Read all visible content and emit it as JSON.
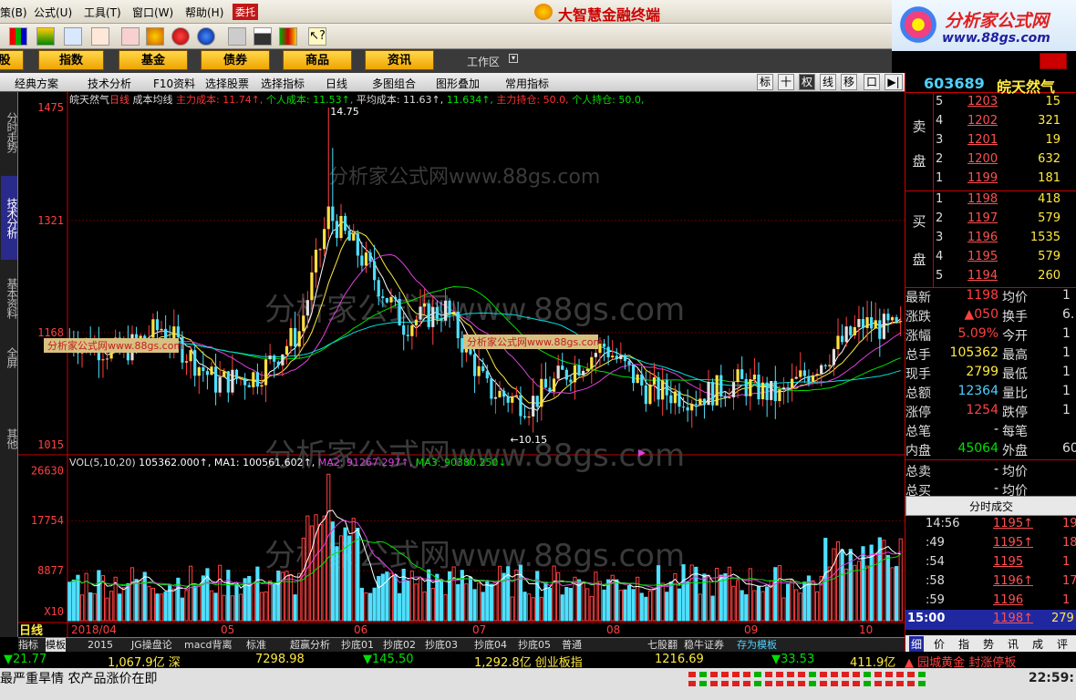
{
  "menu": {
    "items": [
      "策(B)",
      "公式(U)",
      "工具(T)",
      "窗口(W)",
      "帮助(H)"
    ],
    "weituo": "委托",
    "brand": "大智慧金融终端"
  },
  "logo": {
    "title": "分析家公式网",
    "url": "www.88gs.com"
  },
  "categories": [
    "股",
    "指数",
    "基金",
    "债券",
    "商品",
    "资讯"
  ],
  "workspace_label": "工作区",
  "subtoolbar": {
    "left": [
      "经典方案",
      "技术分析",
      "F10资料",
      "选择股票",
      "选择指标",
      "日线",
      "多图组合",
      "图形叠加",
      "常用指标"
    ],
    "right": [
      "标",
      "十",
      "权",
      "线",
      "移",
      "口",
      "▶|"
    ]
  },
  "left_tabs": [
    "分时走势",
    "技术分析",
    "基本资料",
    "全屏",
    "其他"
  ],
  "chart": {
    "header": {
      "name": "皖天然气",
      "period": "日线",
      "indicator": "成本均线",
      "items": [
        {
          "text": "主力成本: 11.74↑,",
          "color": "#ff3030"
        },
        {
          "text": "个人成本: 11.53↑,",
          "color": "#00e000"
        },
        {
          "text": "平均成本: 11.63↑,",
          "color": "#dddddd"
        },
        {
          "text": "11.634↑,",
          "color": "#00e000"
        },
        {
          "text": "主力持仓: 50.0,",
          "color": "#ff3030"
        },
        {
          "text": "个人持仓: 50.0,",
          "color": "#00e000"
        }
      ]
    },
    "price_axis": [
      "1475",
      "1321",
      "1168",
      "1015"
    ],
    "high_label": "14.75",
    "low_label": "←10.15",
    "vol_header": [
      {
        "text": "VOL(5,10,20)",
        "color": "#dddddd"
      },
      {
        "text": "105362.000↑,",
        "color": "#ffffff"
      },
      {
        "text": "MA1: 100561.602↑,",
        "color": "#ffffff"
      },
      {
        "text": "MA2: 91267.297↑,",
        "color": "#e040e0"
      },
      {
        "text": "MA3: 90380.250↓",
        "color": "#00e000"
      }
    ],
    "vol_axis": [
      "26630",
      "17754",
      "8877",
      "X10"
    ],
    "month_labels": [
      "2018/04",
      "05",
      "06",
      "07",
      "08",
      "09",
      "10"
    ],
    "watermark": "分析家公式网www.88gs.com",
    "label_box": "分析家公式网www.88gs.com",
    "period_label": "日线"
  },
  "bottom_tabs": [
    "指标",
    "模板",
    "2015",
    "JG操盘论",
    "macd背离",
    "标准",
    "超赢分析",
    "抄底01",
    "抄底02",
    "抄底03",
    "抄底04",
    "抄底05",
    "普通",
    "七股翻",
    "稳牛证券",
    "存为模板"
  ],
  "right_panel": {
    "code": "603689",
    "name": "皖天然气",
    "sell_label": [
      "卖",
      "盘"
    ],
    "buy_label": [
      "买",
      "盘"
    ],
    "sell": [
      {
        "lv": "5",
        "px": "1203",
        "vol": "15"
      },
      {
        "lv": "4",
        "px": "1202",
        "vol": "321"
      },
      {
        "lv": "3",
        "px": "1201",
        "vol": "19"
      },
      {
        "lv": "2",
        "px": "1200",
        "vol": "632"
      },
      {
        "lv": "1",
        "px": "1199",
        "vol": "181"
      }
    ],
    "buy": [
      {
        "lv": "1",
        "px": "1198",
        "vol": "418"
      },
      {
        "lv": "2",
        "px": "1197",
        "vol": "579"
      },
      {
        "lv": "3",
        "px": "1196",
        "vol": "1535"
      },
      {
        "lv": "4",
        "px": "1195",
        "vol": "579"
      },
      {
        "lv": "5",
        "px": "1194",
        "vol": "260"
      }
    ],
    "quotes": [
      {
        "k": "最新",
        "v": "1198",
        "vc": "red",
        "k2": "均价",
        "v2": "1"
      },
      {
        "k": "涨跌",
        "v": "▲050",
        "vc": "red",
        "k2": "换手",
        "v2": "6."
      },
      {
        "k": "涨幅",
        "v": "5.09%",
        "vc": "red",
        "k2": "今开",
        "v2": "1"
      },
      {
        "k": "总手",
        "v": "105362",
        "vc": "yel",
        "k2": "最高",
        "v2": "1"
      },
      {
        "k": "现手",
        "v": "2799",
        "vc": "yel",
        "k2": "最低",
        "v2": "1"
      },
      {
        "k": "总额",
        "v": "12364",
        "vc": "cyn",
        "k2": "量比",
        "v2": "1"
      },
      {
        "k": "涨停",
        "v": "1254",
        "vc": "red",
        "k2": "跌停",
        "v2": "1"
      },
      {
        "k": "总笔",
        "v": "-",
        "vc": "wht",
        "k2": "每笔",
        "v2": ""
      },
      {
        "k": "内盘",
        "v": "45064",
        "vc": "grn",
        "k2": "外盘",
        "v2": "60"
      },
      {
        "k": "总卖",
        "v": "-",
        "vc": "wht",
        "k2": "均价",
        "v2": ""
      },
      {
        "k": "总买",
        "v": "-",
        "vc": "wht",
        "k2": "均价",
        "v2": ""
      }
    ],
    "ticks_title": "分时成交",
    "ticks": [
      {
        "t": "14:56",
        "p": "1195↑",
        "v": "19"
      },
      {
        "t": ":49",
        "p": "1195↑",
        "v": "18"
      },
      {
        "t": ":54",
        "p": "1195",
        "v": "1"
      },
      {
        "t": ":58",
        "p": "1196↑",
        "v": "17"
      },
      {
        "t": ":59",
        "p": "1196",
        "v": "1"
      }
    ],
    "last_tick": {
      "t": "15:00",
      "p": "1198↑",
      "v": "279"
    },
    "tabs": [
      "细",
      "价",
      "指",
      "势",
      "讯",
      "成",
      "评"
    ]
  },
  "index_bar": [
    {
      "text": "▼21.77",
      "color": "#00e000"
    },
    {
      "text": "1,067.9亿 深",
      "color": "#ffea40"
    },
    {
      "text": "7298.98",
      "color": "#ffea40"
    },
    {
      "text": "▼145.50",
      "color": "#00e000"
    },
    {
      "text": "1,292.8亿 创业板指",
      "color": "#ffea40"
    },
    {
      "text": "1216.69",
      "color": "#ffea40"
    },
    {
      "text": "▼33.53",
      "color": "#00e000"
    },
    {
      "text": "411.9亿",
      "color": "#ffea40"
    },
    {
      "text": "▲ 园城黄金 封涨停板",
      "color": "#ff4040"
    }
  ],
  "status": {
    "news": "最严重旱情 农产品涨价在即",
    "time": "22:59:"
  }
}
